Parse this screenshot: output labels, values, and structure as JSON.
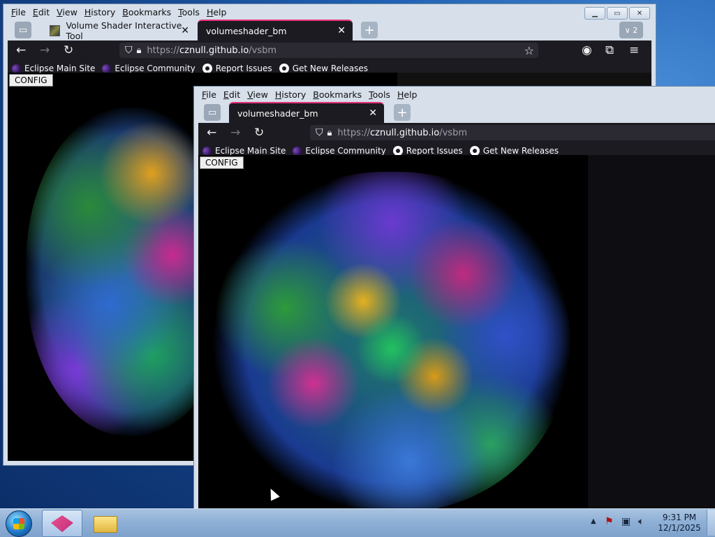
{
  "back_window": {
    "menu": [
      "File",
      "Edit",
      "View",
      "History",
      "Bookmarks",
      "Tools",
      "Help"
    ],
    "tabs": [
      {
        "label": "Volume Shader Interactive Tool",
        "active": false
      },
      {
        "label": "volumeshader_bm",
        "active": true
      }
    ],
    "tab_overflow_count": "2",
    "url": {
      "scheme": "https://",
      "host": "cznull.github.io",
      "path": "/vsbm"
    },
    "bookmarks": [
      {
        "label": "Eclipse Main Site",
        "icon": "eclipse-icon"
      },
      {
        "label": "Eclipse Community",
        "icon": "eclipse-icon"
      },
      {
        "label": "Report Issues",
        "icon": "github-icon"
      },
      {
        "label": "Get New Releases",
        "icon": "github-icon"
      }
    ],
    "config_label": "CONFIG"
  },
  "front_window": {
    "menu": [
      "File",
      "Edit",
      "View",
      "History",
      "Bookmarks",
      "Tools",
      "Help"
    ],
    "tabs": [
      {
        "label": "volumeshader_bm",
        "active": true
      }
    ],
    "url": {
      "scheme": "https://",
      "host": "cznull.github.io",
      "path": "/vsbm"
    },
    "bookmarks": [
      {
        "label": "Eclipse Main Site",
        "icon": "eclipse-icon"
      },
      {
        "label": "Eclipse Community",
        "icon": "eclipse-icon"
      },
      {
        "label": "Report Issues",
        "icon": "github-icon"
      },
      {
        "label": "Get New Releases",
        "icon": "github-icon"
      }
    ],
    "config_label": "CONFIG"
  },
  "taskbar": {
    "time": "9:31 PM",
    "date": "12/1/2025"
  },
  "colors": {
    "accent_tab": "#e9307a",
    "toolbar_bg": "#1c1b22",
    "urlbar_bg": "#2b2a33"
  }
}
